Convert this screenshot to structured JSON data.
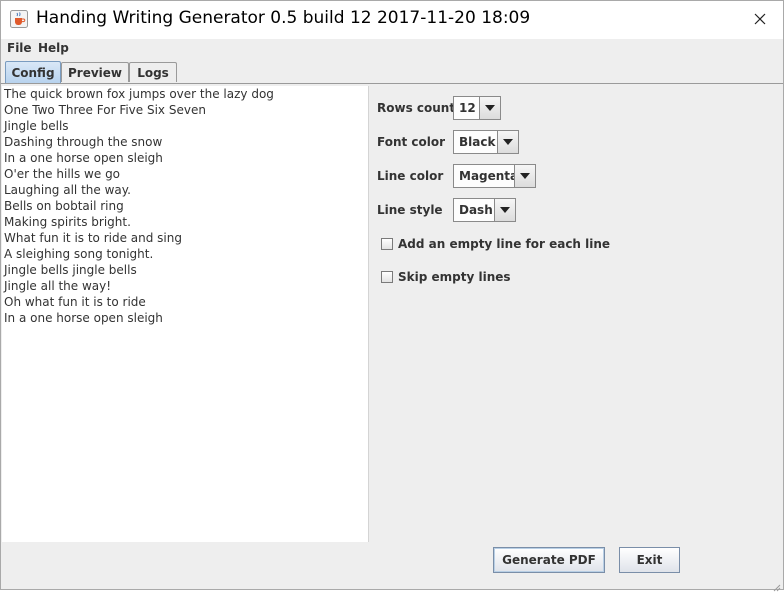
{
  "window": {
    "title": "Handing Writing Generator 0.5 build 12 2017-11-20 18:09"
  },
  "menu": {
    "items": [
      {
        "label": "File"
      },
      {
        "label": "Help"
      }
    ]
  },
  "tabs": [
    {
      "label": "Config",
      "active": true
    },
    {
      "label": "Preview",
      "active": false
    },
    {
      "label": "Logs",
      "active": false
    }
  ],
  "editor": {
    "lines": [
      "The quick brown fox jumps over the lazy dog",
      "One Two Three For Five Six Seven",
      "Jingle bells",
      "Dashing through the snow",
      "In a one horse open sleigh",
      "O'er the hills we go",
      "Laughing all the way.",
      "Bells on bobtail ring",
      "Making spirits bright.",
      "What fun it is to ride and sing",
      "A sleighing song tonight.",
      "Jingle bells jingle bells",
      "Jingle all the way!",
      "Oh what fun it is to ride",
      "In a one horse open sleigh"
    ]
  },
  "settings": {
    "rows_count": {
      "label": "Rows count",
      "value": "12"
    },
    "font_color": {
      "label": "Font color",
      "value": "Black"
    },
    "line_color": {
      "label": "Line color",
      "value": "Magenta"
    },
    "line_style": {
      "label": "Line style",
      "value": "Dash"
    },
    "empty_line_each": {
      "label": "Add an empty line for each line",
      "checked": false
    },
    "skip_empty": {
      "label": "Skip empty lines",
      "checked": false
    }
  },
  "buttons": {
    "generate_label": "Generate PDF",
    "exit_label": "Exit"
  },
  "icons": {
    "app": "java-coffee-icon",
    "close": "close-icon",
    "dropdown": "chevron-down-icon"
  }
}
